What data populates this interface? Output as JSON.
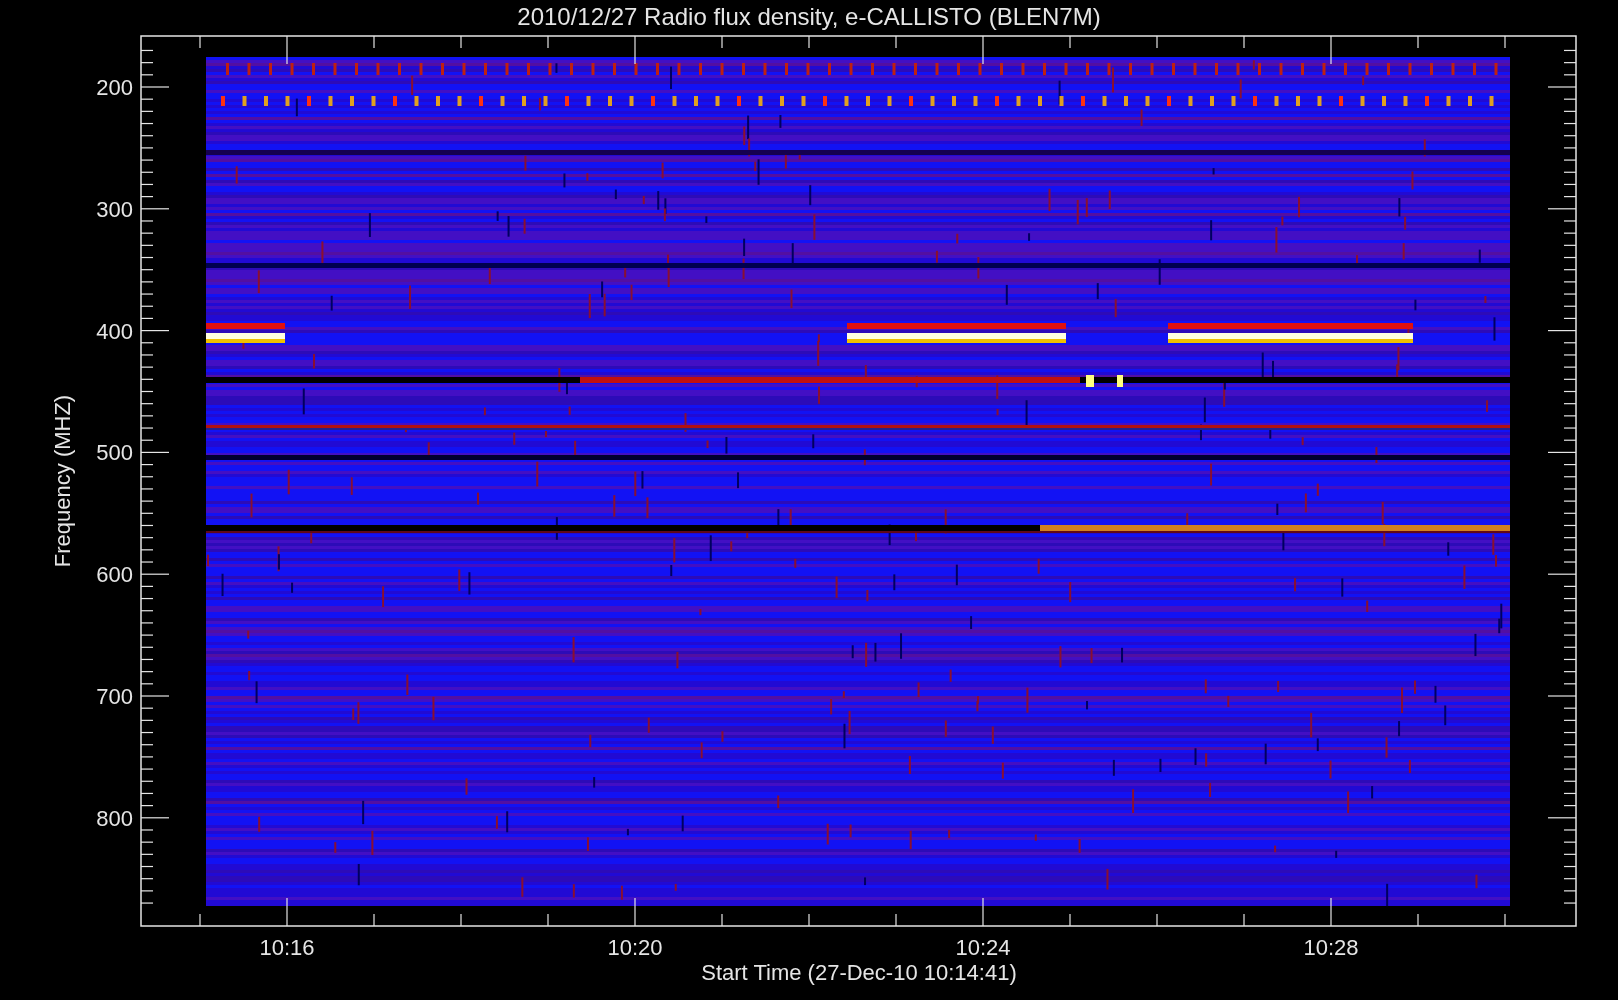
{
  "title": "2010/12/27  Radio flux density, e-CALLISTO (BLEN7M)",
  "y_axis": {
    "label": "Frequency (MHZ)",
    "ticks": [
      "200",
      "300",
      "400",
      "500",
      "600",
      "700",
      "800"
    ]
  },
  "x_axis": {
    "label": "Start Time (27-Dec-10 10:14:41)",
    "ticks": [
      "10:16",
      "10:20",
      "10:24",
      "10:28"
    ]
  }
}
